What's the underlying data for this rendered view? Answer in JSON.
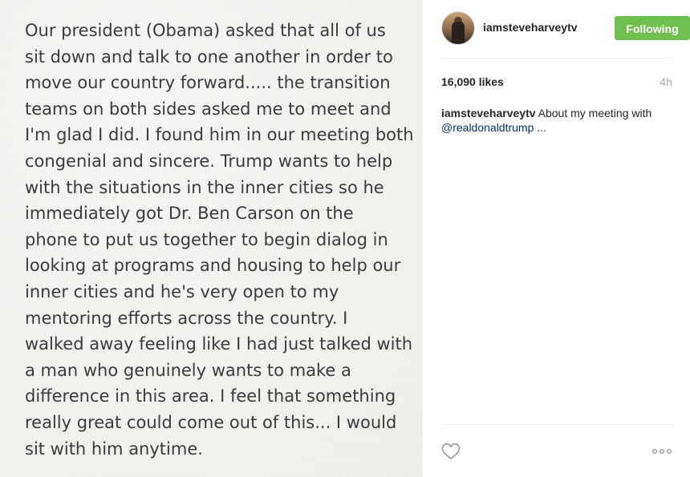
{
  "note": {
    "lines": [
      "Our president (Obama) asked that all of us",
      "sit down and talk to one another in order to",
      "move our country forward..... the transition",
      "teams on both sides asked me to meet and",
      "I'm glad I did. I found him in our meeting both",
      "congenial and sincere. Trump wants to help",
      "with the situations in the inner cities so he",
      "immediately got Dr. Ben Carson on the",
      "phone to put us together to begin dialog in",
      "looking at programs and housing to help our",
      "inner cities and he's very open to my",
      "mentoring efforts across the country. I",
      "walked away feeling like I had just talked with",
      "a man who genuinely wants to make a",
      "difference in this area. I feel that something",
      "really great could come out of this... I would",
      "sit with him anytime."
    ]
  },
  "post": {
    "username": "iamsteveharveytv",
    "follow_label": "Following",
    "likes": "16,090 likes",
    "time_ago": "4h",
    "caption": {
      "user": "iamsteveharveytv",
      "text": " About my meeting with",
      "mention": "@realdonaldtrump",
      "ellipsis": " ..."
    }
  },
  "colors": {
    "following_bg": "#70c050",
    "mention": "#003569",
    "muted": "#a5a7aa"
  },
  "icons": {
    "like": "heart-icon",
    "more": "more-options-icon"
  }
}
